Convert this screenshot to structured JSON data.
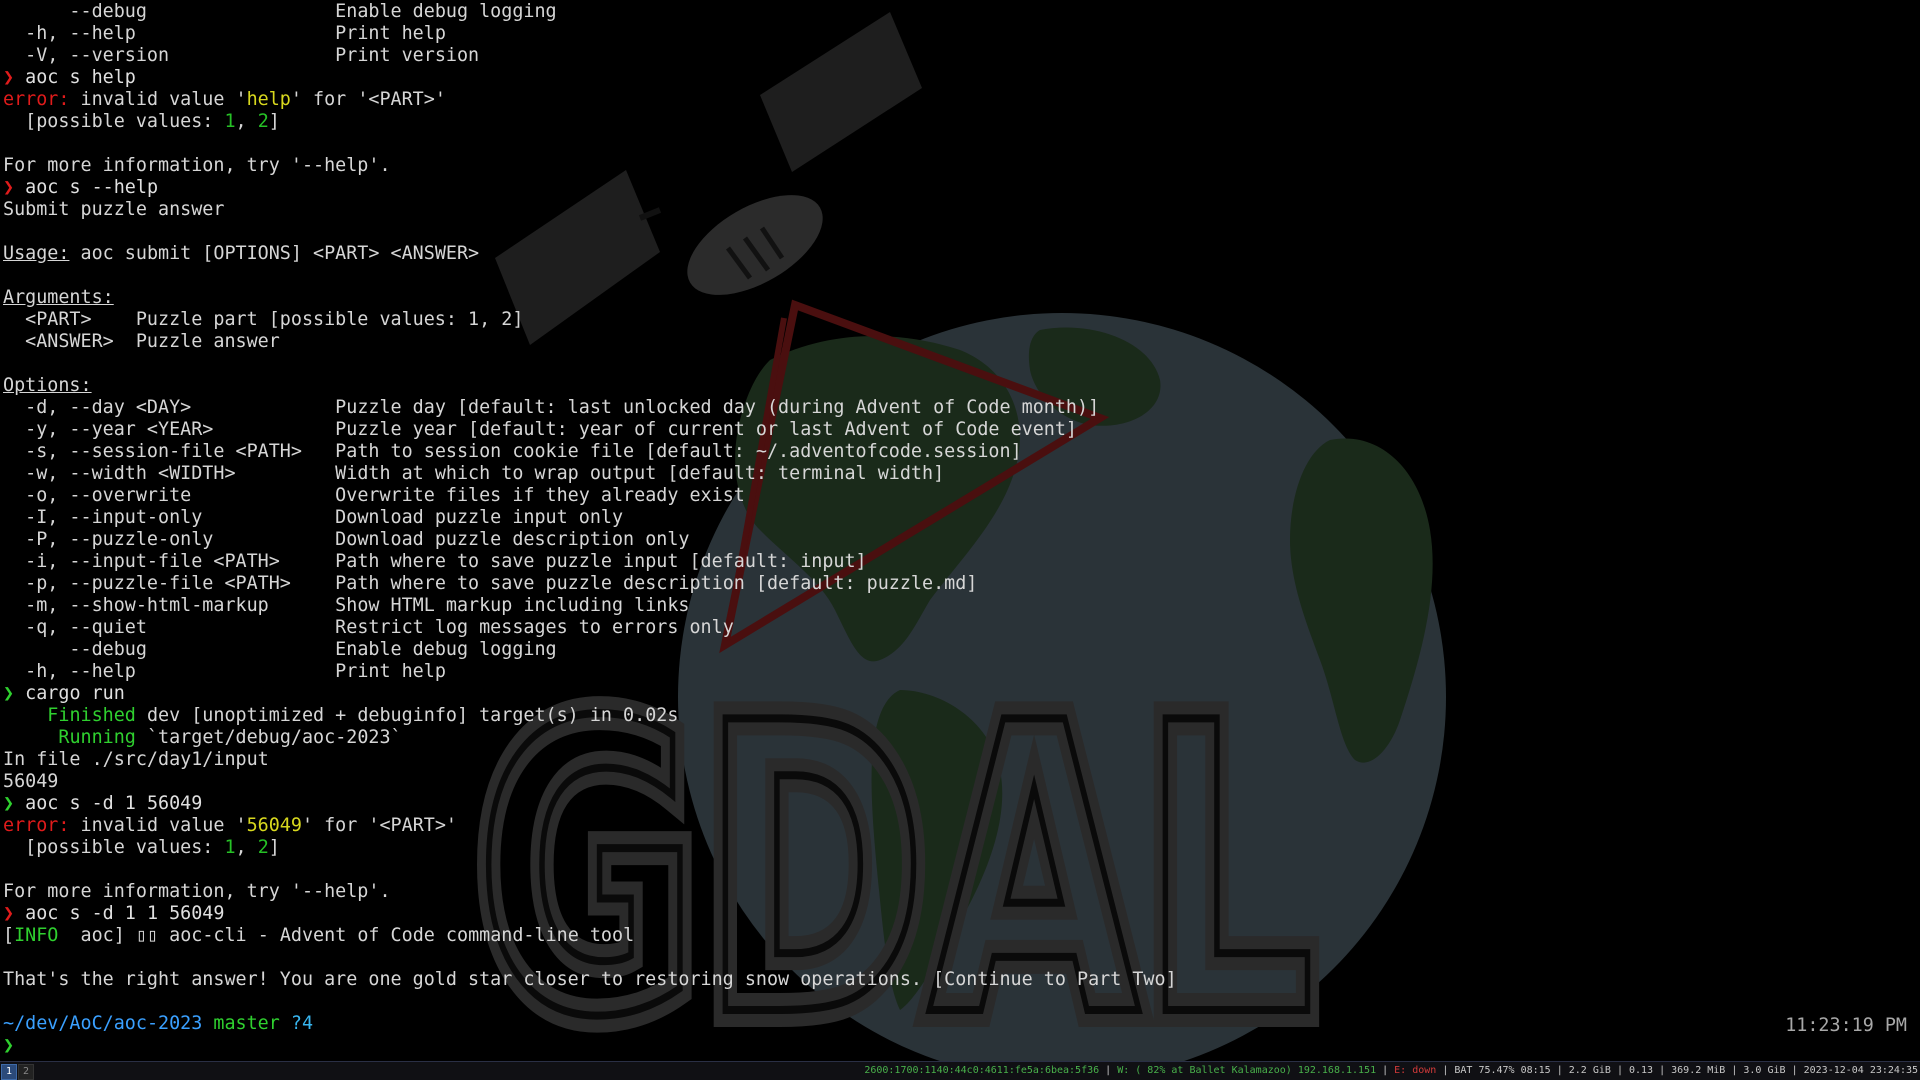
{
  "wallpaper": {
    "logo_text": "GDAL"
  },
  "terminal": {
    "lines": [
      {
        "a": "      --debug                 ",
        "b": "Enable debug logging"
      },
      {
        "a": "  -h, --help                  ",
        "b": "Print help"
      },
      {
        "a": "  -V, --version               ",
        "b": "Print version"
      },
      {
        "prompt": "❯",
        "cmd": " aoc s help"
      },
      {
        "err": "error:",
        "pre": " invalid value '",
        "hl": "help",
        "post": "' for '<PART>'"
      },
      {
        "pre": "  [possible values: ",
        "v1": "1",
        "sep": ", ",
        "v2": "2",
        "post": "]"
      },
      {
        "text": ""
      },
      {
        "text": "For more information, try '--help'."
      },
      {
        "prompt": "❯",
        "cmd": " aoc s --help"
      },
      {
        "text": "Submit puzzle answer"
      },
      {
        "text": ""
      },
      {
        "ul": "Usage:",
        "rest": " aoc submit [OPTIONS] <PART> <ANSWER>"
      },
      {
        "text": ""
      },
      {
        "ul": "Arguments:",
        "rest": ""
      },
      {
        "text": "  <PART>    Puzzle part [possible values: 1, 2]"
      },
      {
        "text": "  <ANSWER>  Puzzle answer"
      },
      {
        "text": ""
      },
      {
        "ul": "Options:",
        "rest": ""
      },
      {
        "a": "  -d, --day <DAY>             ",
        "b": "Puzzle day [default: last unlocked day (during Advent of Code month)]"
      },
      {
        "a": "  -y, --year <YEAR>           ",
        "b": "Puzzle year [default: year of current or last Advent of Code event]"
      },
      {
        "a": "  -s, --session-file <PATH>   ",
        "b": "Path to session cookie file [default: ~/.adventofcode.session]"
      },
      {
        "a": "  -w, --width <WIDTH>         ",
        "b": "Width at which to wrap output [default: terminal width]"
      },
      {
        "a": "  -o, --overwrite             ",
        "b": "Overwrite files if they already exist"
      },
      {
        "a": "  -I, --input-only            ",
        "b": "Download puzzle input only"
      },
      {
        "a": "  -P, --puzzle-only           ",
        "b": "Download puzzle description only"
      },
      {
        "a": "  -i, --input-file <PATH>     ",
        "b": "Path where to save puzzle input [default: input]"
      },
      {
        "a": "  -p, --puzzle-file <PATH>    ",
        "b": "Path where to save puzzle description [default: puzzle.md]"
      },
      {
        "a": "  -m, --show-html-markup      ",
        "b": "Show HTML markup including links"
      },
      {
        "a": "  -q, --quiet                 ",
        "b": "Restrict log messages to errors only"
      },
      {
        "a": "      --debug                 ",
        "b": "Enable debug logging"
      },
      {
        "a": "  -h, --help                  ",
        "b": "Print help"
      },
      {
        "prompt": "❯",
        "cmd": " cargo run"
      },
      {
        "ind": "    ",
        "gw": "Finished",
        "rest": " dev [unoptimized + debuginfo] target(s) in 0.02s"
      },
      {
        "ind": "     ",
        "gw": "Running",
        "rest": " `target/debug/aoc-2023`"
      },
      {
        "text": "In file ./src/day1/input"
      },
      {
        "text": "56049"
      },
      {
        "prompt": "❯",
        "cmd": " aoc s -d 1 56049"
      },
      {
        "err": "error:",
        "pre": " invalid value '",
        "hl": "56049",
        "post": "' for '<PART>'"
      },
      {
        "pre": "  [possible values: ",
        "v1": "1",
        "sep": ", ",
        "v2": "2",
        "post": "]"
      },
      {
        "text": ""
      },
      {
        "text": "For more information, try '--help'."
      },
      {
        "prompt": "❯",
        "cmd": " aoc s -d 1 1 56049"
      },
      {
        "lb": "[",
        "info": "INFO ",
        "mod": " aoc",
        "rb": "]",
        "msg": " ▯▯ aoc-cli - Advent of Code command-line tool"
      },
      {
        "text": ""
      },
      {
        "text": "That's the right answer! You are one gold star closer to restoring snow operations. [Continue to Part Two]"
      },
      {
        "text": ""
      },
      {
        "path1": "~/dev/AoC/",
        "path2": "aoc-2023",
        "branch": " master",
        "status": " ?4"
      },
      {
        "prompt": "❯",
        "cmd": ""
      }
    ],
    "clock": "11:23:19 PM"
  },
  "statusbar": {
    "workspaces": [
      "1",
      "2"
    ],
    "ipv6": "2600:1700:1140:44c0:4611:fe5a:6bea:5f36",
    "wifi": "W: ( 82% at Ballet Kalamazoo) 192.168.1.151",
    "eth": "E: down",
    "battery": "BAT 75.47% 08:15",
    "disk": "2.2 GiB",
    "load": "0.13",
    "mem": "369.2 MiB",
    "swap": "3.0 GiB",
    "datetime": "2023-12-04 23:24:35"
  },
  "colors": {
    "error": "#e01b1b",
    "prompt_red": "#e01b1b",
    "prompt_green": "#2fd02f",
    "highlight": "#d8d81e",
    "cargo_green": "#2fd02f",
    "path_blue": "#3aa0ff",
    "git_branch": "#2fd02f",
    "git_status": "#38b6f0"
  }
}
